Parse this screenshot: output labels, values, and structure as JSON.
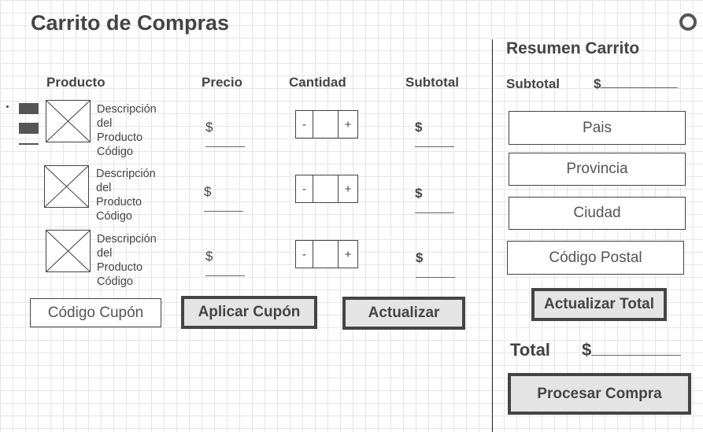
{
  "title": "Carrito de Compras",
  "columns": {
    "product": "Producto",
    "price": "Precio",
    "quantity": "Cantidad",
    "subtotal": "Subtotal"
  },
  "products": [
    {
      "desc1": "Descripción",
      "desc2": "del Producto",
      "desc3": "Código",
      "price": "$",
      "subtotal": "$",
      "minus": "-",
      "plus": "+"
    },
    {
      "desc1": "Descripción",
      "desc2": "del Producto",
      "desc3": "Código",
      "price": "$",
      "subtotal": "$",
      "minus": "-",
      "plus": "+"
    },
    {
      "desc1": "Descripción",
      "desc2": "del Producto",
      "desc3": "Código",
      "price": "$",
      "subtotal": "$",
      "minus": "-",
      "plus": "+"
    }
  ],
  "coupon": {
    "field": "Código Cupón",
    "apply": "Aplicar Cupón",
    "update": "Actualizar"
  },
  "summary": {
    "title": "Resumen Carrito",
    "subtotal_label": "Subtotal",
    "subtotal_value": "$",
    "country": "Pais",
    "province": "Provincia",
    "city": "Ciudad",
    "postal_code": "Código Postal",
    "update_total": "Actualizar Total",
    "total_label": "Total",
    "total_value": "$",
    "checkout": "Procesar Compra"
  },
  "icons": {
    "image_placeholder": "image-placeholder-icon",
    "menu": "menu-icon",
    "status": "circle-icon"
  }
}
